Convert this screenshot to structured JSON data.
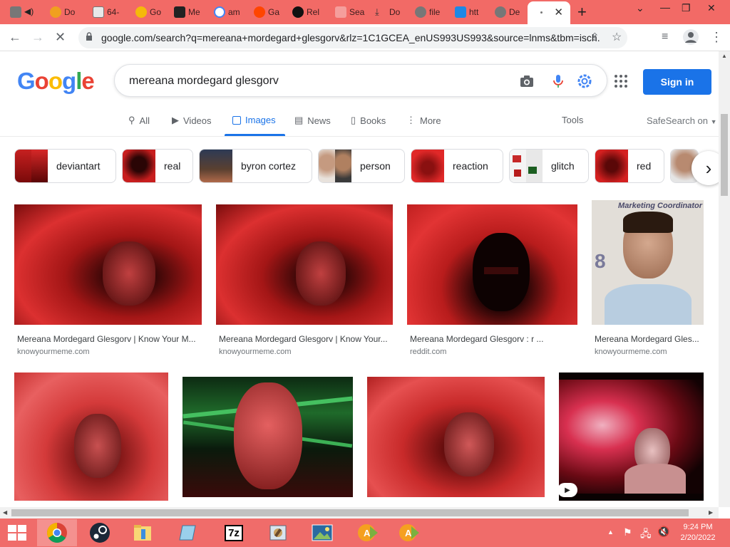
{
  "browser": {
    "tabs": [
      {
        "label": "Do"
      },
      {
        "label": "64-"
      },
      {
        "label": "Go"
      },
      {
        "label": "Me"
      },
      {
        "label": "am"
      },
      {
        "label": "Ga"
      },
      {
        "label": "Rel"
      },
      {
        "label": "Sea"
      },
      {
        "label": "Do"
      },
      {
        "label": "file"
      },
      {
        "label": "htt"
      },
      {
        "label": "De"
      }
    ],
    "address": "google.com/search?q=mereana+mordegard+glesgorv&rlz=1C1GCEA_enUS993US993&source=lnms&tbm=isch..."
  },
  "google": {
    "logo": "Google",
    "query": "mereana mordegard glesgorv",
    "signin_label": "Sign in",
    "nav": {
      "all": "All",
      "videos": "Videos",
      "images": "Images",
      "news": "News",
      "books": "Books",
      "more": "More",
      "tools": "Tools",
      "safesearch": "SafeSearch on"
    },
    "chips": [
      {
        "label": "deviantart"
      },
      {
        "label": "real"
      },
      {
        "label": "byron cortez"
      },
      {
        "label": "person"
      },
      {
        "label": "reaction"
      },
      {
        "label": "glitch"
      },
      {
        "label": "red"
      }
    ],
    "results": [
      {
        "title": "Mereana Mordegard Glesgorv | Know Your M...",
        "source": "knowyourmeme.com"
      },
      {
        "title": "Mereana Mordegard Glesgorv | Know Your...",
        "source": "knowyourmeme.com"
      },
      {
        "title": "Mereana Mordegard Glesgorv : r ...",
        "source": "reddit.com"
      },
      {
        "title": "Mereana Mordegard Gles...",
        "source": "knowyourmeme.com"
      }
    ],
    "thumb_text": {
      "caption": "Marketing Coordinator",
      "digit": "8"
    }
  },
  "taskbar": {
    "time": "9:24 PM",
    "date": "2/20/2022",
    "sevenzip_label": "7z"
  },
  "colors": {
    "tabstrip": "#f26a66",
    "taskbar": "#f06c6a",
    "accent": "#1a73e8"
  }
}
